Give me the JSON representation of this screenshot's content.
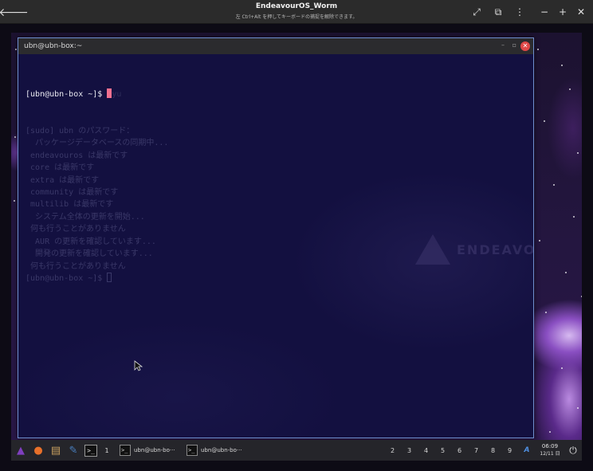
{
  "viewer": {
    "title": "EndeavourOS_Worm",
    "hint": "左 Ctrl+Alt を押してキーボードの捕捉を解除できます。",
    "icons": {
      "back": "back-arrow-icon",
      "fullscreen": "fullscreen-icon",
      "scale": "scale-icon",
      "menu": "kebab-menu-icon",
      "minimize": "minimize-icon",
      "zoom_in": "zoom-in-icon",
      "close": "close-icon"
    },
    "glyphs": {
      "back": "🡐",
      "fullscreen": "⤢",
      "scale": "⧉",
      "menu": "⋮",
      "minimize": "−",
      "zoom_in": "+",
      "close": "✕"
    }
  },
  "terminal": {
    "title": "ubn@ubn-box:~",
    "window_controls": {
      "minimize": "–",
      "restore": "▫",
      "close": "✕"
    },
    "prompt": "[ubn@ubn-box ~]$ ",
    "ghost_after_cursor": "yu",
    "history": [
      "[sudo] ubn のパスワード：",
      "  パッケージデータベースの同期中...",
      " endeavouros は最新です",
      " core は最新です",
      " extra は最新です",
      " community は最新です",
      " multilib は最新です",
      "  システム全体の更新を開始...",
      " 何も行うことがありません",
      "  AUR の更新を確認しています...",
      "  開発の更新を確認しています...",
      " 何も行うことがありません"
    ],
    "last_prompt": "[ubn@ubn-box ~]$ ",
    "watermark": "ENDEAVOUROS"
  },
  "taskbar": {
    "launchers": [
      {
        "name": "endeavouros-launcher-icon",
        "glyph": "▲",
        "color": "#7f3fbf"
      },
      {
        "name": "firefox-icon",
        "glyph": "●",
        "color": "#e8702a"
      },
      {
        "name": "file-manager-icon",
        "glyph": "▤",
        "color": "#c9a060"
      },
      {
        "name": "text-editor-icon",
        "glyph": "✎",
        "color": "#4a7fc0"
      },
      {
        "name": "terminal-launcher-icon",
        "glyph": ">_",
        "color": "#dddddd"
      }
    ],
    "tasks": [
      {
        "label": "ubn@ubn-bo···",
        "ico": ">_"
      },
      {
        "label": "ubn@ubn-bo···",
        "ico": ">_"
      }
    ],
    "workspaces": [
      "1",
      "2",
      "3",
      "4",
      "5",
      "6",
      "7",
      "8",
      "9"
    ],
    "keyboard_indicator": "A",
    "clock": {
      "time": "06:09",
      "date": "12/11 日"
    },
    "power_glyph": "⏻"
  },
  "colors": {
    "accent": "#6f8fcf",
    "cursor": "#f07090",
    "close": "#e04848"
  }
}
